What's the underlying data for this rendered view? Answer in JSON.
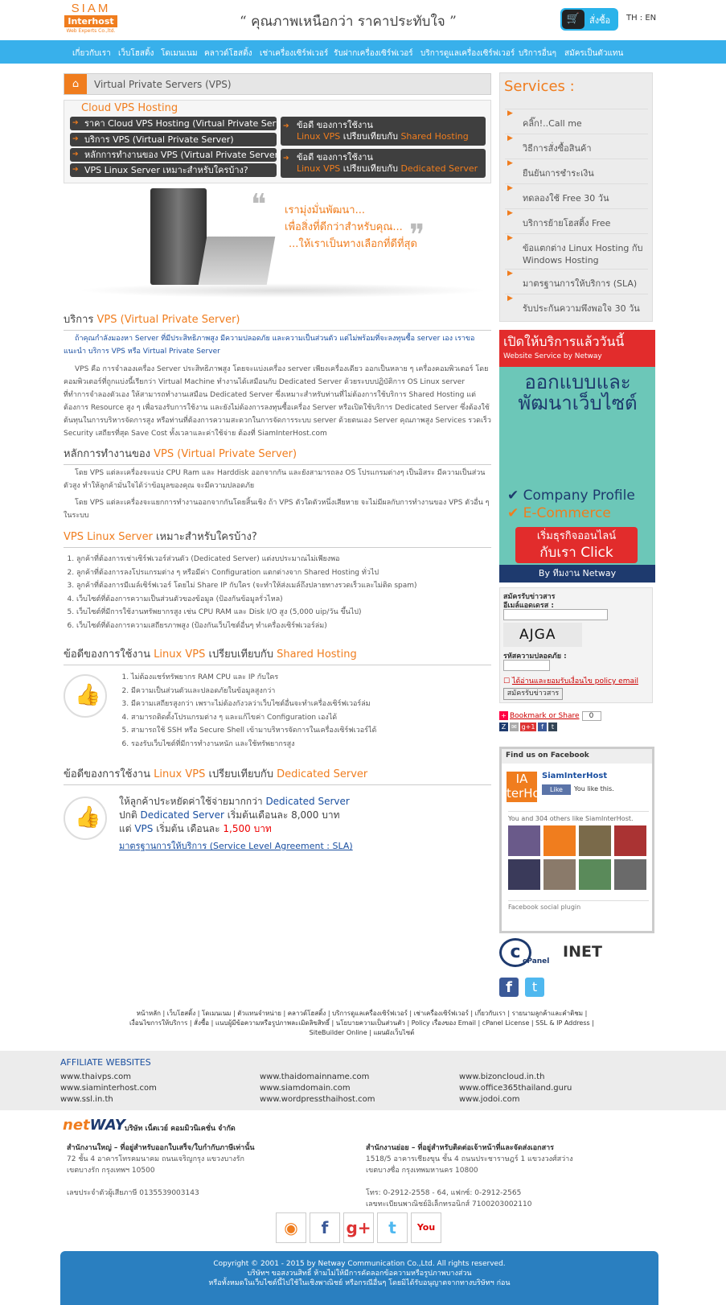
{
  "header": {
    "logo_top": "SIAM",
    "logo_mid": "Interhost",
    "logo_sub": "Web Experts Co.,ltd.",
    "slogan": "“ คุณภาพเหนือกว่า ราคาประทับใจ ”",
    "cart_label": "สั่งซื้อ",
    "lang": "TH : EN"
  },
  "nav": [
    "เกี่ยวกับเรา",
    "เว็บโฮสติ้ง",
    "โดเมนเนม",
    "คลาวด์โฮสติ้ง",
    "เช่าเครื่องเซิร์ฟเวอร์",
    "รับฝากเครื่องเซิร์ฟเวอร์",
    "บริการดูแลเครื่องเซิร์ฟเวอร์",
    "บริการอื่นๆ",
    "สมัครเป็นตัวแทน"
  ],
  "breadcrumb": "Virtual Private Servers (VPS)",
  "cloudbox": {
    "title": "Cloud VPS Hosting",
    "links": [
      "ราคา Cloud VPS Hosting (Virtual Private Server)",
      "บริการ VPS (Virtual Private Server)",
      "หลักการทำงานของ VPS (Virtual Private Server)",
      "VPS Linux Server เหมาะสำหรับใครบ้าง?"
    ],
    "cmp1": {
      "l1": "ข้อดี ของการใช้งาน",
      "l2a": "Linux VPS",
      "l2b": " เปรียบเทียบกับ ",
      "l2c": "Shared Hosting"
    },
    "cmp2": {
      "l1": "ข้อดี ของการใช้งาน",
      "l2a": "Linux VPS",
      "l2b": " เปรียบเทียบกับ ",
      "l2c": "Dedicated Server"
    }
  },
  "banner": {
    "l1": "เรามุ่งมั่นพัฒนา...",
    "l2": "เพื่อสิ่งที่ดีกว่าสำหรับคุณ...",
    "l3": "...ให้เราเป็นทางเลือกที่ดีที่สุด"
  },
  "s1": {
    "pre": "บริการ ",
    "hl": "VPS (Virtual Private Server)",
    "p1": "ถ้าคุณกำลังมองหา Server ที่มีประสิทธิภาพสูง มีความปลอดภัย และความเป็นส่วนตัว แต่ไม่พร้อมที่จะลงทุนซื้อ server เอง เราขอแนะนำ บริการ VPS หรือ Virtual Private Server",
    "p2": "VPS คือ การจำลองเครื่อง Server ประสิทธิภาพสูง โดยจะแบ่งเครื่อง server เพียงเครื่องเดียว ออกเป็นหลาย ๆ เครื่องคอมพิวเตอร์ โดยคอมพิวเตอร์ที่ถูกแบ่งนี้เรียกว่า Virtual Machine ทำงานได้เสมือนกับ Dedicated Server ด้วยระบบปฏิบัติการ OS Linux server ที่ทำการจำลองตัวเอง ให้สามารถทำงานเสมือน Dedicated Server ซึ่งเหมาะสำหรับท่านที่ไม่ต้องการใช้บริการ Shared Hosting แต่ต้องการ Resource สูง ๆ เพื่อรองรับการใช้งาน และยังไม่ต้องการลงทุนซื้อเครื่อง Server หรือเปิดใช้บริการ Dedicated Server ซึ่งต้องใช้ต้นทุนในการบริหารจัดการสูง หรือท่านที่ต้องการความสะดวกในการจัดการระบบ server ด้วยตนเอง Server คุณภาพสูง Services รวดเร็ว Security เสถียรที่สุด Save Cost ทั้งเวลาและค่าใช้จ่าย ต้องที่ SiamInterHost.com"
  },
  "s2": {
    "pre": "หลักการทำงานของ ",
    "hl": "VPS (Virtual Private Server)",
    "p1": "โดย VPS แต่ละเครื่องจะแบ่ง CPU Ram และ Harddisk ออกจากกัน และยังสามารถลง OS โปรแกรมต่างๆ เป็นอิสระ มีความเป็นส่วนตัวสูง ทำให้ลูกค้ามั่นใจได้ว่าข้อมูลของคุณ จะมีความปลอดภัย",
    "p2": "โดย VPS แต่ละเครื่องจะแยกการทำงานออกจากกันโดยสิ้นเชิง ถ้า VPS ตัวใดตัวหนึ่งเสียหาย จะไม่มีผลกับการทำงานของ VPS ตัวอื่น ๆ ในระบบ"
  },
  "s3": {
    "hl": "VPS Linux Server",
    "post": " เหมาะสำหรับใครบ้าง?",
    "items": [
      "ลูกค้าที่ต้องการเช่าเซิร์ฟเวอร์ส่วนตัว (Dedicated Server) แต่งบประมาณไม่เพียงพอ",
      "ลูกค้าที่ต้องการลงโปรแกรมต่าง ๆ หรือมีค่า Configuration แตกต่างจาก Shared Hosting ทั่วไป",
      "ลูกค้าที่ต้องการมีเมล์เซิร์ฟเวอร์ โดยไม่ Share IP กับใคร (จะทำให้ส่งเมล์ถึงปลายทางรวดเร็วและไม่ติด spam)",
      "เว็บไซต์ที่ต้องการความเป็นส่วนตัวของข้อมูล (ป้องกันข้อมูลรั่วไหล)",
      "เว็บไซต์ที่มีการใช้งานทรัพยากรสูง เช่น CPU RAM และ Disk I/O สูง (5,000 uip/วัน ขึ้นไป)",
      "เว็บไซต์ที่ต้องการความเสถียรภาพสูง (ป้องกันเว็บไซต์อื่นๆ ทำเครื่องเซิร์ฟเวอร์ล่ม)"
    ]
  },
  "s4": {
    "pre": "ข้อดีของการใช้งาน ",
    "hl": "Linux VPS",
    "mid": " เปรียบเทียบกับ ",
    "hl2": "Shared Hosting",
    "items": [
      "ไม่ต้องแชร์ทรัพยากร RAM CPU และ IP กับใคร",
      "มีความเป็นส่วนตัวและปลอดภัยในข้อมูลสูงกว่า",
      "มีความเสถียรสูงกว่า เพราะไม่ต้องกังวลว่าเว็บไซต์อื่นจะทำเครื่องเซิร์ฟเวอร์ล่ม",
      "สามารถติดตั้งโปรแกรมต่าง ๆ และแก้ไขค่า Configuration เองได้",
      "สามารถใช้ SSH หรือ Secure Shell เข้ามาบริหารจัดการในเครื่องเซิร์ฟเวอร์ได้",
      "รองรับเว็บไซต์ที่มีการทำงานหนัก และใช้ทรัพยากรสูง"
    ]
  },
  "s5": {
    "pre": "ข้อดีของการใช้งาน ",
    "hl": "Linux VPS",
    "mid": " เปรียบเทียบกับ ",
    "hl2": "Dedicated Server",
    "l1a": "ให้ลูกค้าประหยัดค่าใช้จ่ายมากกว่า ",
    "l1b": "Dedicated Server",
    "l2a": "ปกติ ",
    "l2b": "Dedicated Server",
    "l2c": " เริ่มต้นเดือนละ 8,000 บาท",
    "l3a": "แต่ ",
    "l3b": "VPS",
    "l3c": " เริ่มต้น เดือนละ ",
    "l3d": "1,500 บาท",
    "sla": "มาตรฐานการให้บริการ (Service Level Agreement : SLA)"
  },
  "services": {
    "title": "Services :",
    "items": [
      "คลิ๊ก!..Call me",
      "วิธีการสั่งซื้อสินค้า",
      "ยืนยันการชำระเงิน",
      "ทดลองใช้ Free 30 วัน",
      "บริการย้ายโฮสติ้ง Free",
      "ข้อแตกต่าง Linux Hosting กับ Windows Hosting",
      "มาตรฐานการให้บริการ (SLA)",
      "รับประกันความพึงพอใจ 30 วัน"
    ]
  },
  "promo": {
    "h1": "เปิดให้บริการแล้ววันนี้",
    "h2": "Website Service by Netway",
    "t1": "ออกแบบและ",
    "t2": "พัฒนาเว็บไซต์",
    "c1": "Company Profile",
    "c2": "E-Commerce",
    "r1": "เริ่มธุรกิจออนไลน์",
    "r2": "กับเรา Click",
    "by": "By ทีมงาน Netway"
  },
  "newsletter": {
    "title": "สมัครรับข่าวสาร",
    "email": "อีเมล์แอดเดรส :",
    "captcha": "AJGA",
    "sec": "รหัสความปลอดภัย :",
    "agree": "ได้อ่านและยอมรับเงื่อนไข policy email",
    "submit": "สมัครรับข่าวสาร"
  },
  "bookmark": {
    "label": "Bookmark or Share",
    "count": "0"
  },
  "facebook": {
    "head": "Find us on Facebook",
    "logo": "IA terHo",
    "name": "SiamInterHost",
    "like": "Like",
    "you": "You like this.",
    "others": "You and 304 others like SiamInterHost.",
    "plugin": "Facebook social plugin"
  },
  "partners": {
    "cpanel": "cPanel",
    "inet": "INET"
  },
  "footer_links": "หน้าหลัก | เว็บโฮสติ้ง | โดเมนเนม | ตัวแทนจำหน่าย | คลาวด์โฮสติ้ง | บริการดูแลเครื่องเซิร์ฟเวอร์ | เช่าเครื่องเซิร์ฟเวอร์ | เกี่ยวกับเรา | รายนามลูกค้าและคำติชม | เงื่อนไขการให้บริการ | สั่งซื้อ | แนบผู้มีข้อความหรือรูปภาพละเมิดลิขสิทธิ์ | นโยบายความเป็นส่วนตัว | Policy เรื่องของ Email | cPanel License | SSL & IP Address | SiteBuilder Online | แผนผังเว็บไซต์",
  "affiliate": {
    "title": "AFFILIATE WEBSITES",
    "links": [
      "www.thaivps.com",
      "www.siaminterhost.com",
      "www.ssl.in.th",
      "www.thaidomainname.com",
      "www.siamdomain.com",
      "www.wordpressthaihost.com",
      "www.bizoncloud.in.th",
      "www.office365thailand.guru",
      "www.jodoi.com"
    ]
  },
  "company": {
    "logo_a": "net",
    "logo_b": "WAY",
    "name": "บริษัท เน็ตเวย์ คอมมิวนิเคชั่น จำกัด",
    "hq_title": "สำนักงานใหญ่ – ที่อยู่สำหรับออกใบเสร็จ/ใบกำกับภาษีเท่านั้น",
    "hq_l1": "72 ชั้น 4 อาคารโทรคมนาคม ถนนเจริญกรุง แขวงบางรัก",
    "hq_l2": "เขตบางรัก กรุงเทพฯ 10500",
    "hq_tax": "เลขประจำตัวผู้เสียภาษี 0135539003143",
    "br_title": "สำนักงานย่อย – ที่อยู่สำหรับติดต่อเจ้าหน้าที่และจัดส่งเอกสาร",
    "br_l1": "1518/5 อาคารเชียงขุน ชั้น 4 ถนนประชาราษฎร์ 1 แขวงวงศ์สว่าง",
    "br_l2": "เขตบางซื่อ กรุงเทพมหานคร 10800",
    "br_tel": "โทร: 0-2912-2558 - 64, แฟกซ์: 0-2912-2565",
    "br_reg": "เลขทะเบียนพาณิชย์อิเล็กทรอนิกส์ 7100203002110"
  },
  "copyright": {
    "l1": "Copyright © 2001 - 2015 by Netway Communication Co.,Ltd. All rights reserved.",
    "l2": "บริษัทฯ ขอสงวนสิทธิ์ ห้ามไม่ให้มีการคัดลอกข้อความหรือรูปภาพบางส่วน",
    "l3": "หรือทั้งหมดในเว็บไซต์นี้ไปใช้ในเชิงพาณิชย์ หรือกรณีอื่นๆ โดยมิได้รับอนุญาตจากทางบริษัทฯ ก่อน"
  }
}
